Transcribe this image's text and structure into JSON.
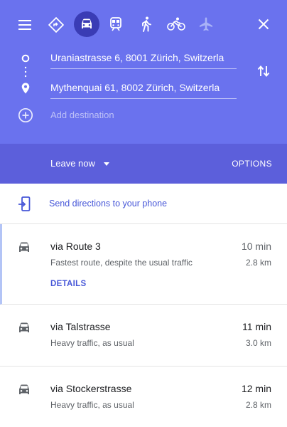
{
  "header": {
    "travel_modes": [
      {
        "name": "best-travel-mode",
        "selected": false
      },
      {
        "name": "driving",
        "selected": true
      },
      {
        "name": "transit",
        "selected": false
      },
      {
        "name": "walking",
        "selected": false
      },
      {
        "name": "cycling",
        "selected": false
      },
      {
        "name": "flights",
        "selected": false
      }
    ],
    "origin": "Uraniastrasse 6, 8001 Zürich, Switzerla",
    "destination": "Mythenquai 61, 8002 Zürich, Switzerla",
    "add_destination": "Add destination"
  },
  "time_bar": {
    "leave_label": "Leave now",
    "options_label": "OPTIONS"
  },
  "send": {
    "label": "Send directions to your phone"
  },
  "routes": [
    {
      "title": "via Route 3",
      "description": "Fastest route, despite the usual traffic",
      "time": "10 min",
      "distance": "2.8 km",
      "details": "DETAILS",
      "selected": true
    },
    {
      "title": "via Talstrasse",
      "description": "Heavy traffic, as usual",
      "time": "11 min",
      "distance": "3.0 km",
      "selected": false
    },
    {
      "title": "via Stockerstrasse",
      "description": "Heavy traffic, as usual",
      "time": "12 min",
      "distance": "2.8 km",
      "selected": false
    }
  ],
  "colors": {
    "header": "#6a72ee",
    "header_dark": "#5c5fdb",
    "selected_mode": "#3a3cb5",
    "link": "#4757d8"
  }
}
